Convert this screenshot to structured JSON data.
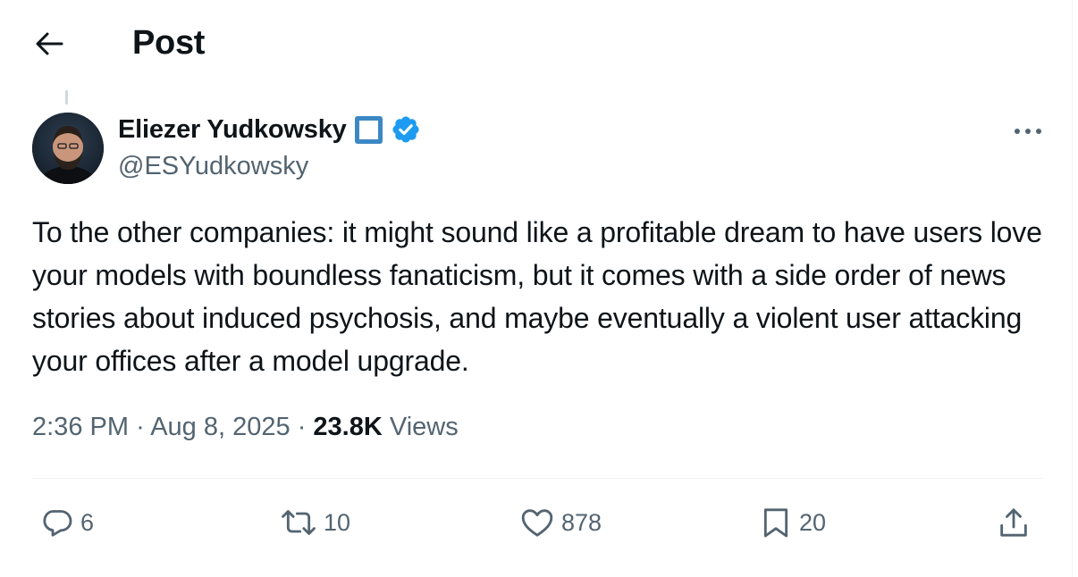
{
  "header": {
    "title": "Post"
  },
  "author": {
    "name": "Eliezer Yudkowsky",
    "handle": "@ESYudkowsky"
  },
  "post": {
    "text": "To the other companies: it might sound like a profitable dream to have users love your models with boundless fanaticism, but it comes with a side order of news stories about induced psychosis, and maybe eventually a violent user attacking your offices after a model upgrade.",
    "time": "2:36 PM",
    "separator": "·",
    "date": "Aug 8, 2025",
    "views_count": "23.8K",
    "views_label": "Views"
  },
  "actions": {
    "replies": "6",
    "reposts": "10",
    "likes": "878",
    "bookmarks": "20"
  },
  "icons": {
    "back": "arrow-left-icon",
    "emoji_badge": "blue-square-icon",
    "verified": "verified-badge-icon",
    "more": "more-dots-icon",
    "reply": "reply-icon",
    "repost": "repost-icon",
    "like": "heart-icon",
    "bookmark": "bookmark-icon",
    "share": "share-icon"
  },
  "colors": {
    "text": "#0f1419",
    "secondary": "#536471",
    "verified": "#1d9bf0",
    "badge_square": "#3b88c3"
  }
}
